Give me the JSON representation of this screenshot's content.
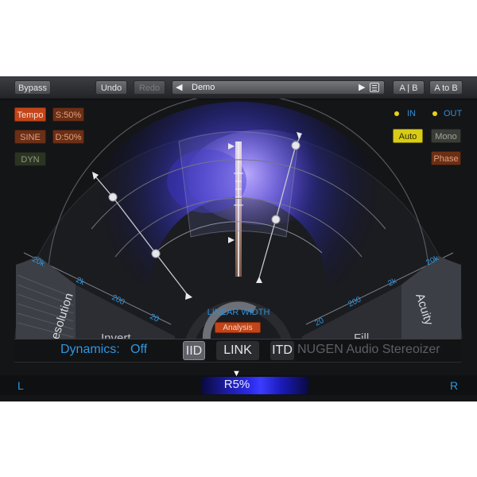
{
  "toolbar": {
    "bypass": "Bypass",
    "undo": "Undo",
    "redo": "Redo",
    "preset_left": "◀",
    "preset_name": "Demo",
    "preset_right": "▶",
    "ab": "A | B",
    "atob": "A to B"
  },
  "left_controls": {
    "tempo": "Tempo",
    "s50": "S:50%",
    "sine": "SINE",
    "d50": "D:50%",
    "dyn": "DYN"
  },
  "right_controls": {
    "in": "IN",
    "out": "OUT",
    "auto": "Auto",
    "mono": "Mono",
    "phase": "Phase"
  },
  "scale": {
    "left_ticks": [
      "20k",
      "2k",
      "200",
      "20"
    ],
    "right_ticks": [
      "20",
      "200",
      "2k",
      "20k"
    ]
  },
  "labels": {
    "resolution": "Resolution",
    "invert": "Invert",
    "fill": "Fill",
    "acuity": "Acuity",
    "linear_width": "LINEAR WIDTH",
    "analysis": "Analysis"
  },
  "lower": {
    "dynamics": "Dynamics:",
    "dynamics_value": "Off",
    "iid": "IID",
    "link": "LINK",
    "itd": "ITD",
    "brand": "NUGEN Audio Stereoizer"
  },
  "bottom": {
    "l": "L",
    "r": "R",
    "meter_value": "R5%"
  },
  "colors": {
    "accent_blue": "#2d97e0",
    "orange": "#c2451a",
    "yellow": "#d8cc18"
  }
}
